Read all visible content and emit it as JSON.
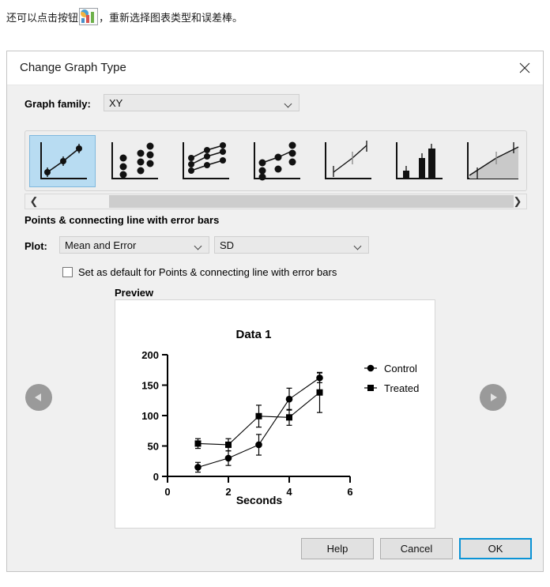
{
  "intro": {
    "text_before": "还可以点击按钮",
    "icon": "chart-type-icon",
    "text_after": "，重新选择图表类型和误差棒。"
  },
  "dialog": {
    "title": "Change Graph Type",
    "close_icon": "close-icon"
  },
  "graph_family": {
    "label": "Graph family:",
    "value": "XY",
    "caret_icon": "chevron-down-icon"
  },
  "gallery": {
    "thumbnails": [
      {
        "name": "points-connecting-line-with-error-bars",
        "selected": true
      },
      {
        "name": "scatter-dot-plot",
        "selected": false
      },
      {
        "name": "points-with-connecting-lines",
        "selected": false
      },
      {
        "name": "points-and-connecting-line-scatter",
        "selected": false
      },
      {
        "name": "line-with-error-bars",
        "selected": false
      },
      {
        "name": "bars-with-error-bars",
        "selected": false
      },
      {
        "name": "area-with-error-bars",
        "selected": false
      }
    ],
    "scroll_left_icon": "chevron-left-icon",
    "scroll_right_icon": "chevron-right-icon"
  },
  "plot_type": {
    "heading": "Points & connecting line with error bars",
    "plot_label": "Plot:",
    "plot_value": "Mean and Error",
    "error_value": "SD",
    "default_checkbox_label": "Set as default for Points & connecting line with error bars",
    "default_checked": false
  },
  "preview": {
    "heading": "Preview",
    "prev_icon": "arrow-left-circle-icon",
    "next_icon": "arrow-right-circle-icon"
  },
  "footer": {
    "help_label": "Help",
    "cancel_label": "Cancel",
    "ok_label": "OK"
  },
  "colors": {
    "accent": "#0a93d6",
    "selected_thumb": "#b8dcf2",
    "dialog_bg": "#f0f0f0",
    "control_series": "#000000",
    "treated_series": "#000000"
  },
  "chart_data": {
    "type": "line",
    "title": "Data 1",
    "xlabel": "Seconds",
    "ylabel": "",
    "x": [
      1,
      2,
      3,
      4,
      5
    ],
    "xlim": [
      0,
      6
    ],
    "ylim": [
      0,
      200
    ],
    "xticks": [
      0,
      2,
      4,
      6
    ],
    "yticks": [
      0,
      50,
      100,
      150,
      200
    ],
    "grid": false,
    "legend_position": "right",
    "error_type": "SD",
    "series": [
      {
        "name": "Control",
        "marker": "circle",
        "values": [
          15,
          30,
          52,
          127,
          162
        ],
        "errors": [
          8,
          12,
          17,
          18,
          8
        ]
      },
      {
        "name": "Treated",
        "marker": "square",
        "values": [
          54,
          52,
          99,
          97,
          138
        ],
        "errors": [
          8,
          10,
          18,
          13,
          33
        ]
      }
    ]
  }
}
